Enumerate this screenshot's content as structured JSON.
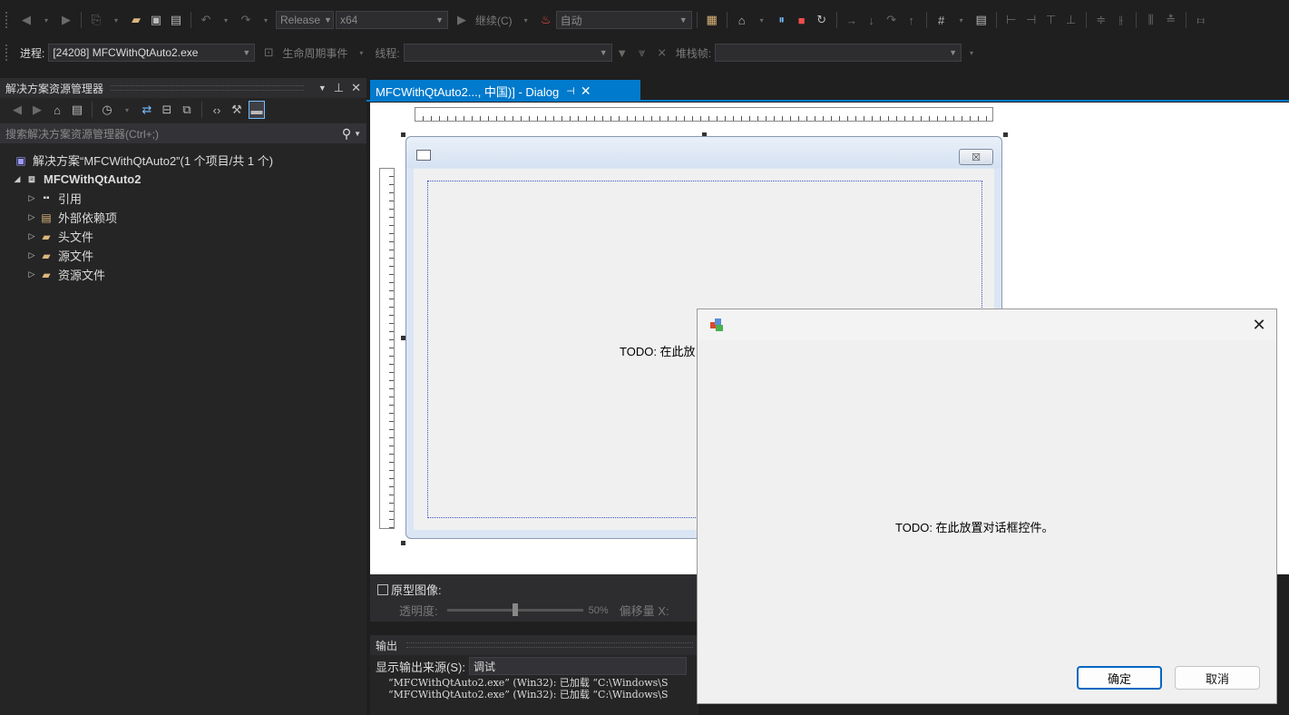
{
  "toolbar": {
    "config": "Release",
    "platform": "x64",
    "continue_label": "继续(C)",
    "auto_label": "自动"
  },
  "debug_toolbar": {
    "process_label": "进程:",
    "process_value": "[24208] MFCWithQtAuto2.exe",
    "lifecycle_label": "生命周期事件",
    "thread_label": "线程:",
    "stackframe_label": "堆栈帧:"
  },
  "solution_explorer": {
    "title": "解决方案资源管理器",
    "search_placeholder": "搜索解决方案资源管理器(Ctrl+;)",
    "solution_label": "解决方案“MFCWithQtAuto2”(1 个项目/共 1 个)",
    "project": "MFCWithQtAuto2",
    "items": [
      {
        "label": "引用",
        "icon": "reference-icon"
      },
      {
        "label": "外部依赖项",
        "icon": "external-deps-icon"
      },
      {
        "label": "头文件",
        "icon": "filter-folder-icon"
      },
      {
        "label": "源文件",
        "icon": "filter-folder-icon"
      },
      {
        "label": "资源文件",
        "icon": "filter-folder-icon"
      }
    ]
  },
  "document_tab": {
    "label": "MFCWithQtAuto2...,  中国)] - Dialog"
  },
  "designer": {
    "todo_text": "TODO: 在此放",
    "close_glyph": "☒"
  },
  "prototype": {
    "checkbox_label": "原型图像:",
    "opacity_label": "透明度:",
    "opacity_value": "50%",
    "opacity_fraction": 0.5,
    "offset_label": "偏移量 X:"
  },
  "output": {
    "title": "输出",
    "source_label": "显示输出来源(S):",
    "source_value": "调试",
    "lines": [
      "“MFCWithQtAuto2.exe” (Win32): 已加载 “C:\\Windows\\S",
      "“MFCWithQtAuto2.exe” (Win32): 已加载 “C:\\Windows\\S"
    ]
  },
  "running_dialog": {
    "todo_text": "TODO: 在此放置对话框控件。",
    "ok_label": "确定",
    "cancel_label": "取消"
  },
  "colors": {
    "accent": "#007acc",
    "ide_background": "#1f1f1f",
    "panel_background": "#252526",
    "dialog_background": "#f0f0f0",
    "default_button_border": "#0067c0"
  }
}
